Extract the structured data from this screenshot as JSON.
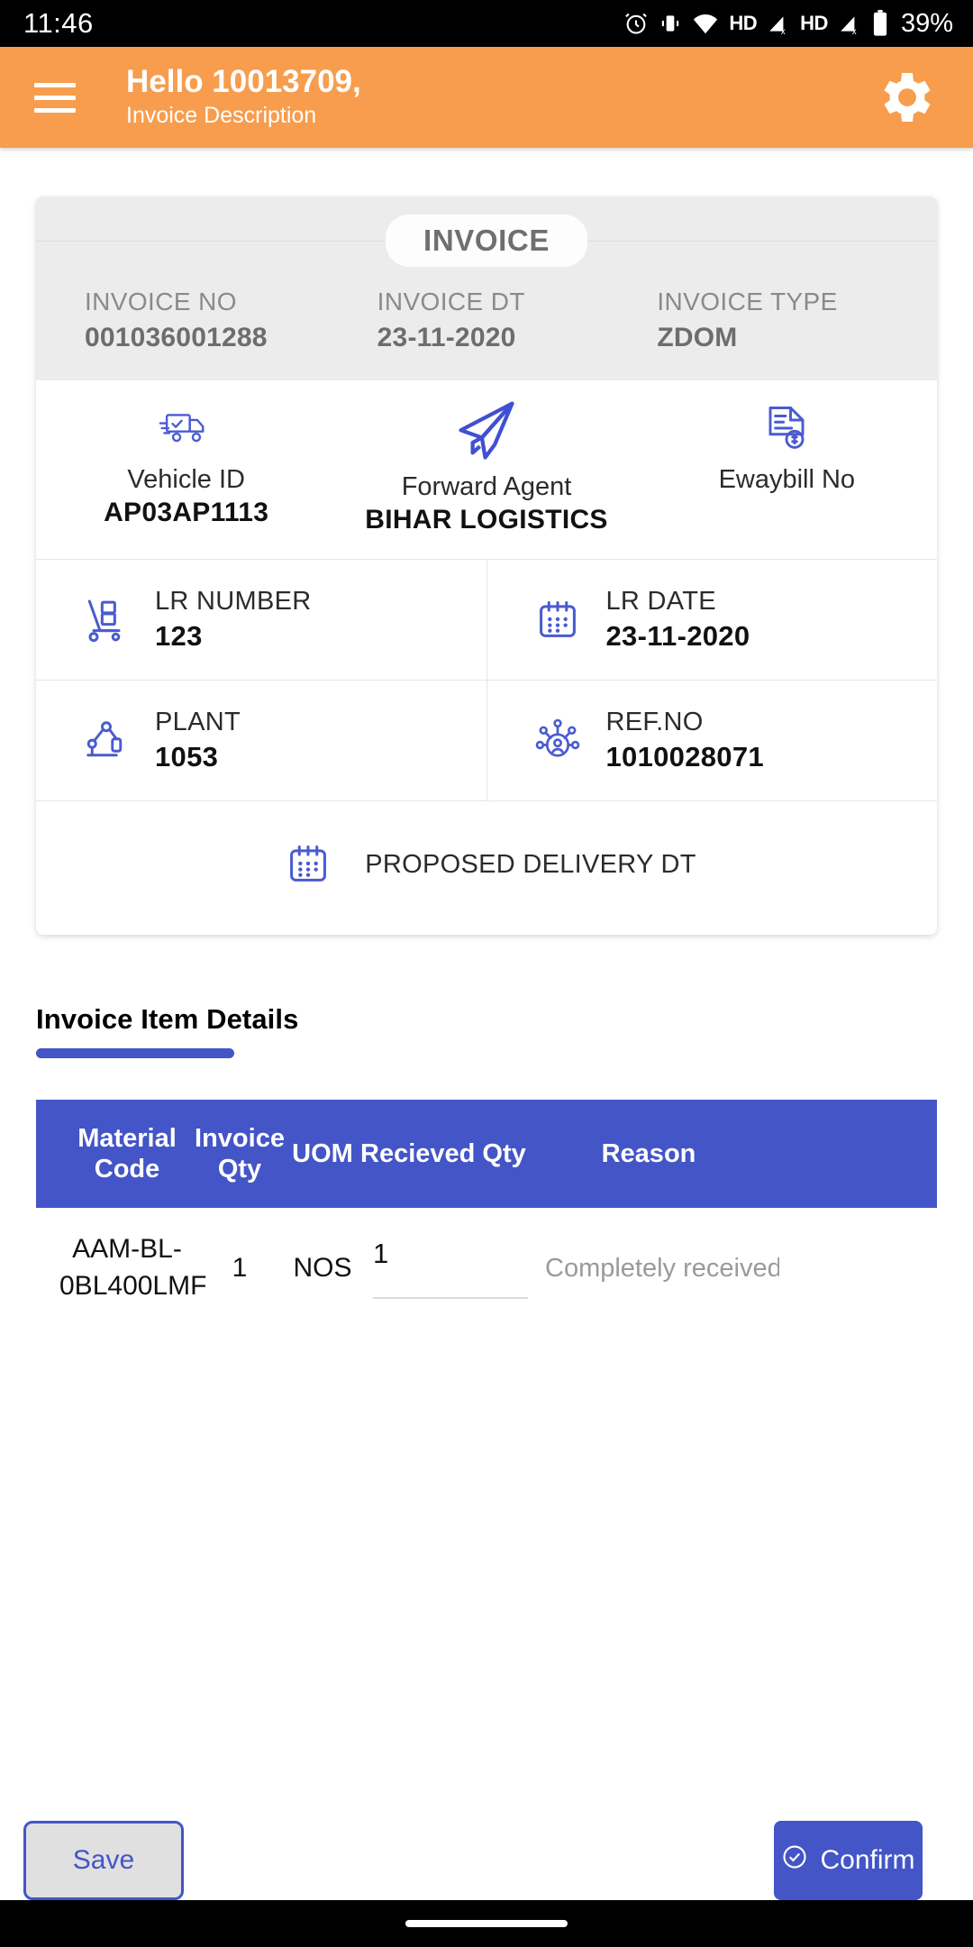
{
  "statusbar": {
    "time": "11:46",
    "hd_label_1": "HD",
    "hd_label_2": "HD",
    "battery": "39%",
    "icons": [
      "alarm-icon",
      "vibrate-icon",
      "wifi-icon",
      "signal-off-icon",
      "signal-off-icon",
      "battery-icon"
    ]
  },
  "appbar": {
    "menu_icon": "hamburger-menu-icon",
    "greeting": "Hello 10013709,",
    "subtitle": "Invoice Description",
    "settings_icon": "gear-icon"
  },
  "invoice_card": {
    "pill_label": "INVOICE",
    "header_fields": [
      {
        "label": "INVOICE NO",
        "value": "001036001288"
      },
      {
        "label": "INVOICE DT",
        "value": "23-11-2020"
      },
      {
        "label": "INVOICE TYPE",
        "value": "ZDOM"
      }
    ],
    "row_icons": [
      {
        "icon": "truck-check-icon",
        "label": "Vehicle ID",
        "value": "AP03AP1113"
      },
      {
        "icon": "paper-plane-icon",
        "label": "Forward Agent",
        "value": "BIHAR LOGISTICS"
      },
      {
        "icon": "ewaybill-doc-icon",
        "label": "Ewaybill No",
        "value": ""
      }
    ],
    "detail_rows": [
      {
        "icon": "hand-truck-icon",
        "label": "LR NUMBER",
        "value": "123"
      },
      {
        "icon": "calendar-icon",
        "label": "LR DATE",
        "value": "23-11-2020"
      },
      {
        "icon": "robot-arm-icon",
        "label": "PLANT",
        "value": "1053"
      },
      {
        "icon": "network-user-icon",
        "label": "REF.NO",
        "value": "1010028071"
      }
    ],
    "proposed_delivery": {
      "icon": "calendar-icon",
      "label": "PROPOSED DELIVERY DT",
      "value": ""
    }
  },
  "item_section": {
    "title": "Invoice Item Details"
  },
  "item_table": {
    "columns": [
      "Material Code",
      "Invoice Qty",
      "UOM",
      "Recieved Qty",
      "Reason"
    ],
    "rows": [
      {
        "material_code": "AAM-BL-0BL400LMF",
        "invoice_qty": "1",
        "uom": "NOS",
        "recieved_qty": "1",
        "reason": "Completely received"
      }
    ]
  },
  "footer": {
    "save_label": "Save",
    "confirm_label": "Confirm",
    "confirm_icon": "check-circle-icon"
  },
  "colors": {
    "accent_orange": "#f79d4d",
    "accent_blue": "#4355c7",
    "header_grey": "#ececec"
  }
}
